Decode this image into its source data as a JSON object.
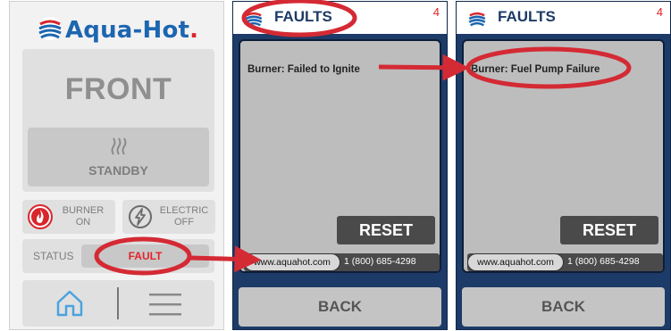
{
  "home": {
    "logo_text": "Aqua-Hot",
    "logo_dot": ".",
    "zone_label": "FRONT",
    "mode_label": "STANDBY",
    "burner": {
      "label": "BURNER",
      "state": "ON"
    },
    "electric": {
      "label": "ELECTRIC",
      "state": "OFF"
    },
    "status_label": "STATUS",
    "status_value": "FAULT"
  },
  "fault_screens": [
    {
      "title": "FAULTS",
      "count": "4",
      "fault_text": "Burner: Failed to Ignite",
      "reset_label": "RESET",
      "website": "www.aquahot.com",
      "phone": "1 (800) 685-4298",
      "back_label": "BACK"
    },
    {
      "title": "FAULTS",
      "count": "4",
      "fault_text": "Burner: Fuel Pump Failure",
      "reset_label": "RESET",
      "website": "www.aquahot.com",
      "phone": "1 (800) 685-4298",
      "back_label": "BACK"
    }
  ],
  "colors": {
    "brand_blue": "#1d66b0",
    "brand_red": "#d9262c",
    "fault_red": "#e3232b",
    "panel_navy": "#1d3b68",
    "annotation_red": "#d42a34",
    "home_icon_blue": "#4aa3df"
  },
  "icons": [
    "aqua-hot-logo-icon",
    "heat-waves-icon",
    "flame-icon",
    "lightning-icon",
    "home-icon",
    "menu-icon"
  ]
}
